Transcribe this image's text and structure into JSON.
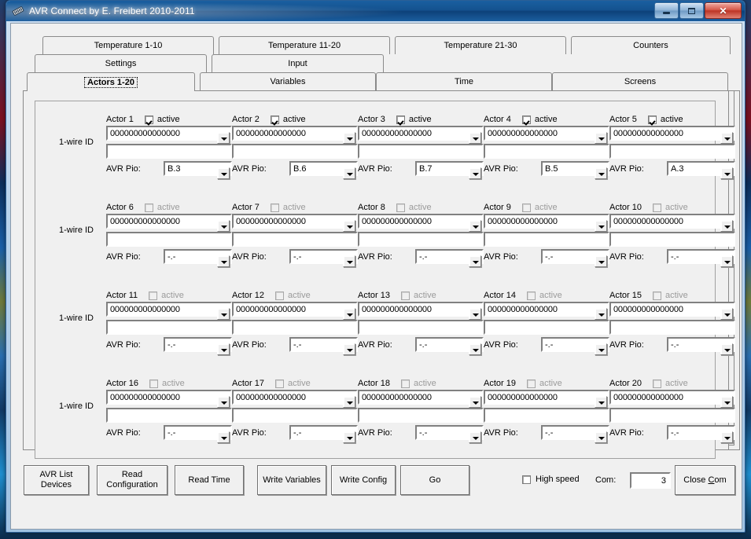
{
  "window": {
    "title": "AVR Connect by E. Freibert 2010-2011",
    "icon": "app-icon",
    "buttons": {
      "minimize": "–",
      "maximize": "□",
      "close": "✕"
    },
    "titlebar_color": "#14528f"
  },
  "tabs": {
    "row1": [
      {
        "label": "Temperature 1-10",
        "selected": false
      },
      {
        "label": "Temperature 11-20",
        "selected": false
      },
      {
        "label": "Temperature 21-30",
        "selected": false
      },
      {
        "label": "Counters",
        "selected": false
      }
    ],
    "row2": [
      {
        "label": "Settings",
        "selected": false
      },
      {
        "label": "Input",
        "selected": false
      }
    ],
    "row3": [
      {
        "label": "Actors 1-20",
        "selected": true
      },
      {
        "label": "Variables",
        "selected": false
      },
      {
        "label": "Time",
        "selected": false
      },
      {
        "label": "Screens",
        "selected": false
      }
    ]
  },
  "actors_panel": {
    "wire_id_label": "1-wire ID",
    "pio_label": "AVR Pio:",
    "active_label": "active",
    "default_id": "000000000000000",
    "pio_empty": "-.-",
    "rows": [
      {
        "cells": [
          {
            "name": "Actor 1",
            "active": true,
            "id": "000000000000000",
            "note": "",
            "pio": "B.3"
          },
          {
            "name": "Actor 2",
            "active": true,
            "id": "000000000000000",
            "note": "",
            "pio": "B.6"
          },
          {
            "name": "Actor 3",
            "active": true,
            "id": "000000000000000",
            "note": "",
            "pio": "B.7"
          },
          {
            "name": "Actor 4",
            "active": true,
            "id": "000000000000000",
            "note": "",
            "pio": "B.5"
          },
          {
            "name": "Actor 5",
            "active": true,
            "id": "000000000000000",
            "note": "",
            "pio": "A.3"
          }
        ]
      },
      {
        "cells": [
          {
            "name": "Actor 6",
            "active": false,
            "id": "000000000000000",
            "note": "",
            "pio": "-.-"
          },
          {
            "name": "Actor 7",
            "active": false,
            "id": "000000000000000",
            "note": "",
            "pio": "-.-"
          },
          {
            "name": "Actor 8",
            "active": false,
            "id": "000000000000000",
            "note": "",
            "pio": "-.-"
          },
          {
            "name": "Actor 9",
            "active": false,
            "id": "000000000000000",
            "note": "",
            "pio": "-.-"
          },
          {
            "name": "Actor 10",
            "active": false,
            "id": "000000000000000",
            "note": "",
            "pio": "-.-"
          }
        ]
      },
      {
        "cells": [
          {
            "name": "Actor 11",
            "active": false,
            "id": "000000000000000",
            "note": "",
            "pio": "-.-"
          },
          {
            "name": "Actor 12",
            "active": false,
            "id": "000000000000000",
            "note": "",
            "pio": "-.-"
          },
          {
            "name": "Actor 13",
            "active": false,
            "id": "000000000000000",
            "note": "",
            "pio": "-.-"
          },
          {
            "name": "Actor 14",
            "active": false,
            "id": "000000000000000",
            "note": "",
            "pio": "-.-"
          },
          {
            "name": "Actor 15",
            "active": false,
            "id": "000000000000000",
            "note": "",
            "pio": "-.-"
          }
        ]
      },
      {
        "cells": [
          {
            "name": "Actor 16",
            "active": false,
            "id": "000000000000000",
            "note": "",
            "pio": "-.-"
          },
          {
            "name": "Actor 17",
            "active": false,
            "id": "000000000000000",
            "note": "",
            "pio": "-.-"
          },
          {
            "name": "Actor 18",
            "active": false,
            "id": "000000000000000",
            "note": "",
            "pio": "-.-"
          },
          {
            "name": "Actor 19",
            "active": false,
            "id": "000000000000000",
            "note": "",
            "pio": "-.-"
          },
          {
            "name": "Actor 20",
            "active": false,
            "id": "000000000000000",
            "note": "",
            "pio": "-.-"
          }
        ]
      }
    ]
  },
  "bottom_bar": {
    "buttons": [
      {
        "key": "avr_list_devices",
        "line1": "AVR List",
        "line2": "Devices"
      },
      {
        "key": "read_configuration",
        "line1": "Read",
        "line2": "Configuration"
      },
      {
        "key": "read_time",
        "line1": "Read Time",
        "line2": ""
      },
      {
        "key": "write_variables",
        "line1": "Write Variables",
        "line2": ""
      },
      {
        "key": "write_config",
        "line1": "Write Config",
        "line2": ""
      },
      {
        "key": "go",
        "line1": "Go",
        "line2": ""
      }
    ],
    "high_speed_label": "High speed",
    "high_speed_checked": false,
    "com_label": "Com:",
    "com_value": "3",
    "close_com_label": "Close Com"
  }
}
